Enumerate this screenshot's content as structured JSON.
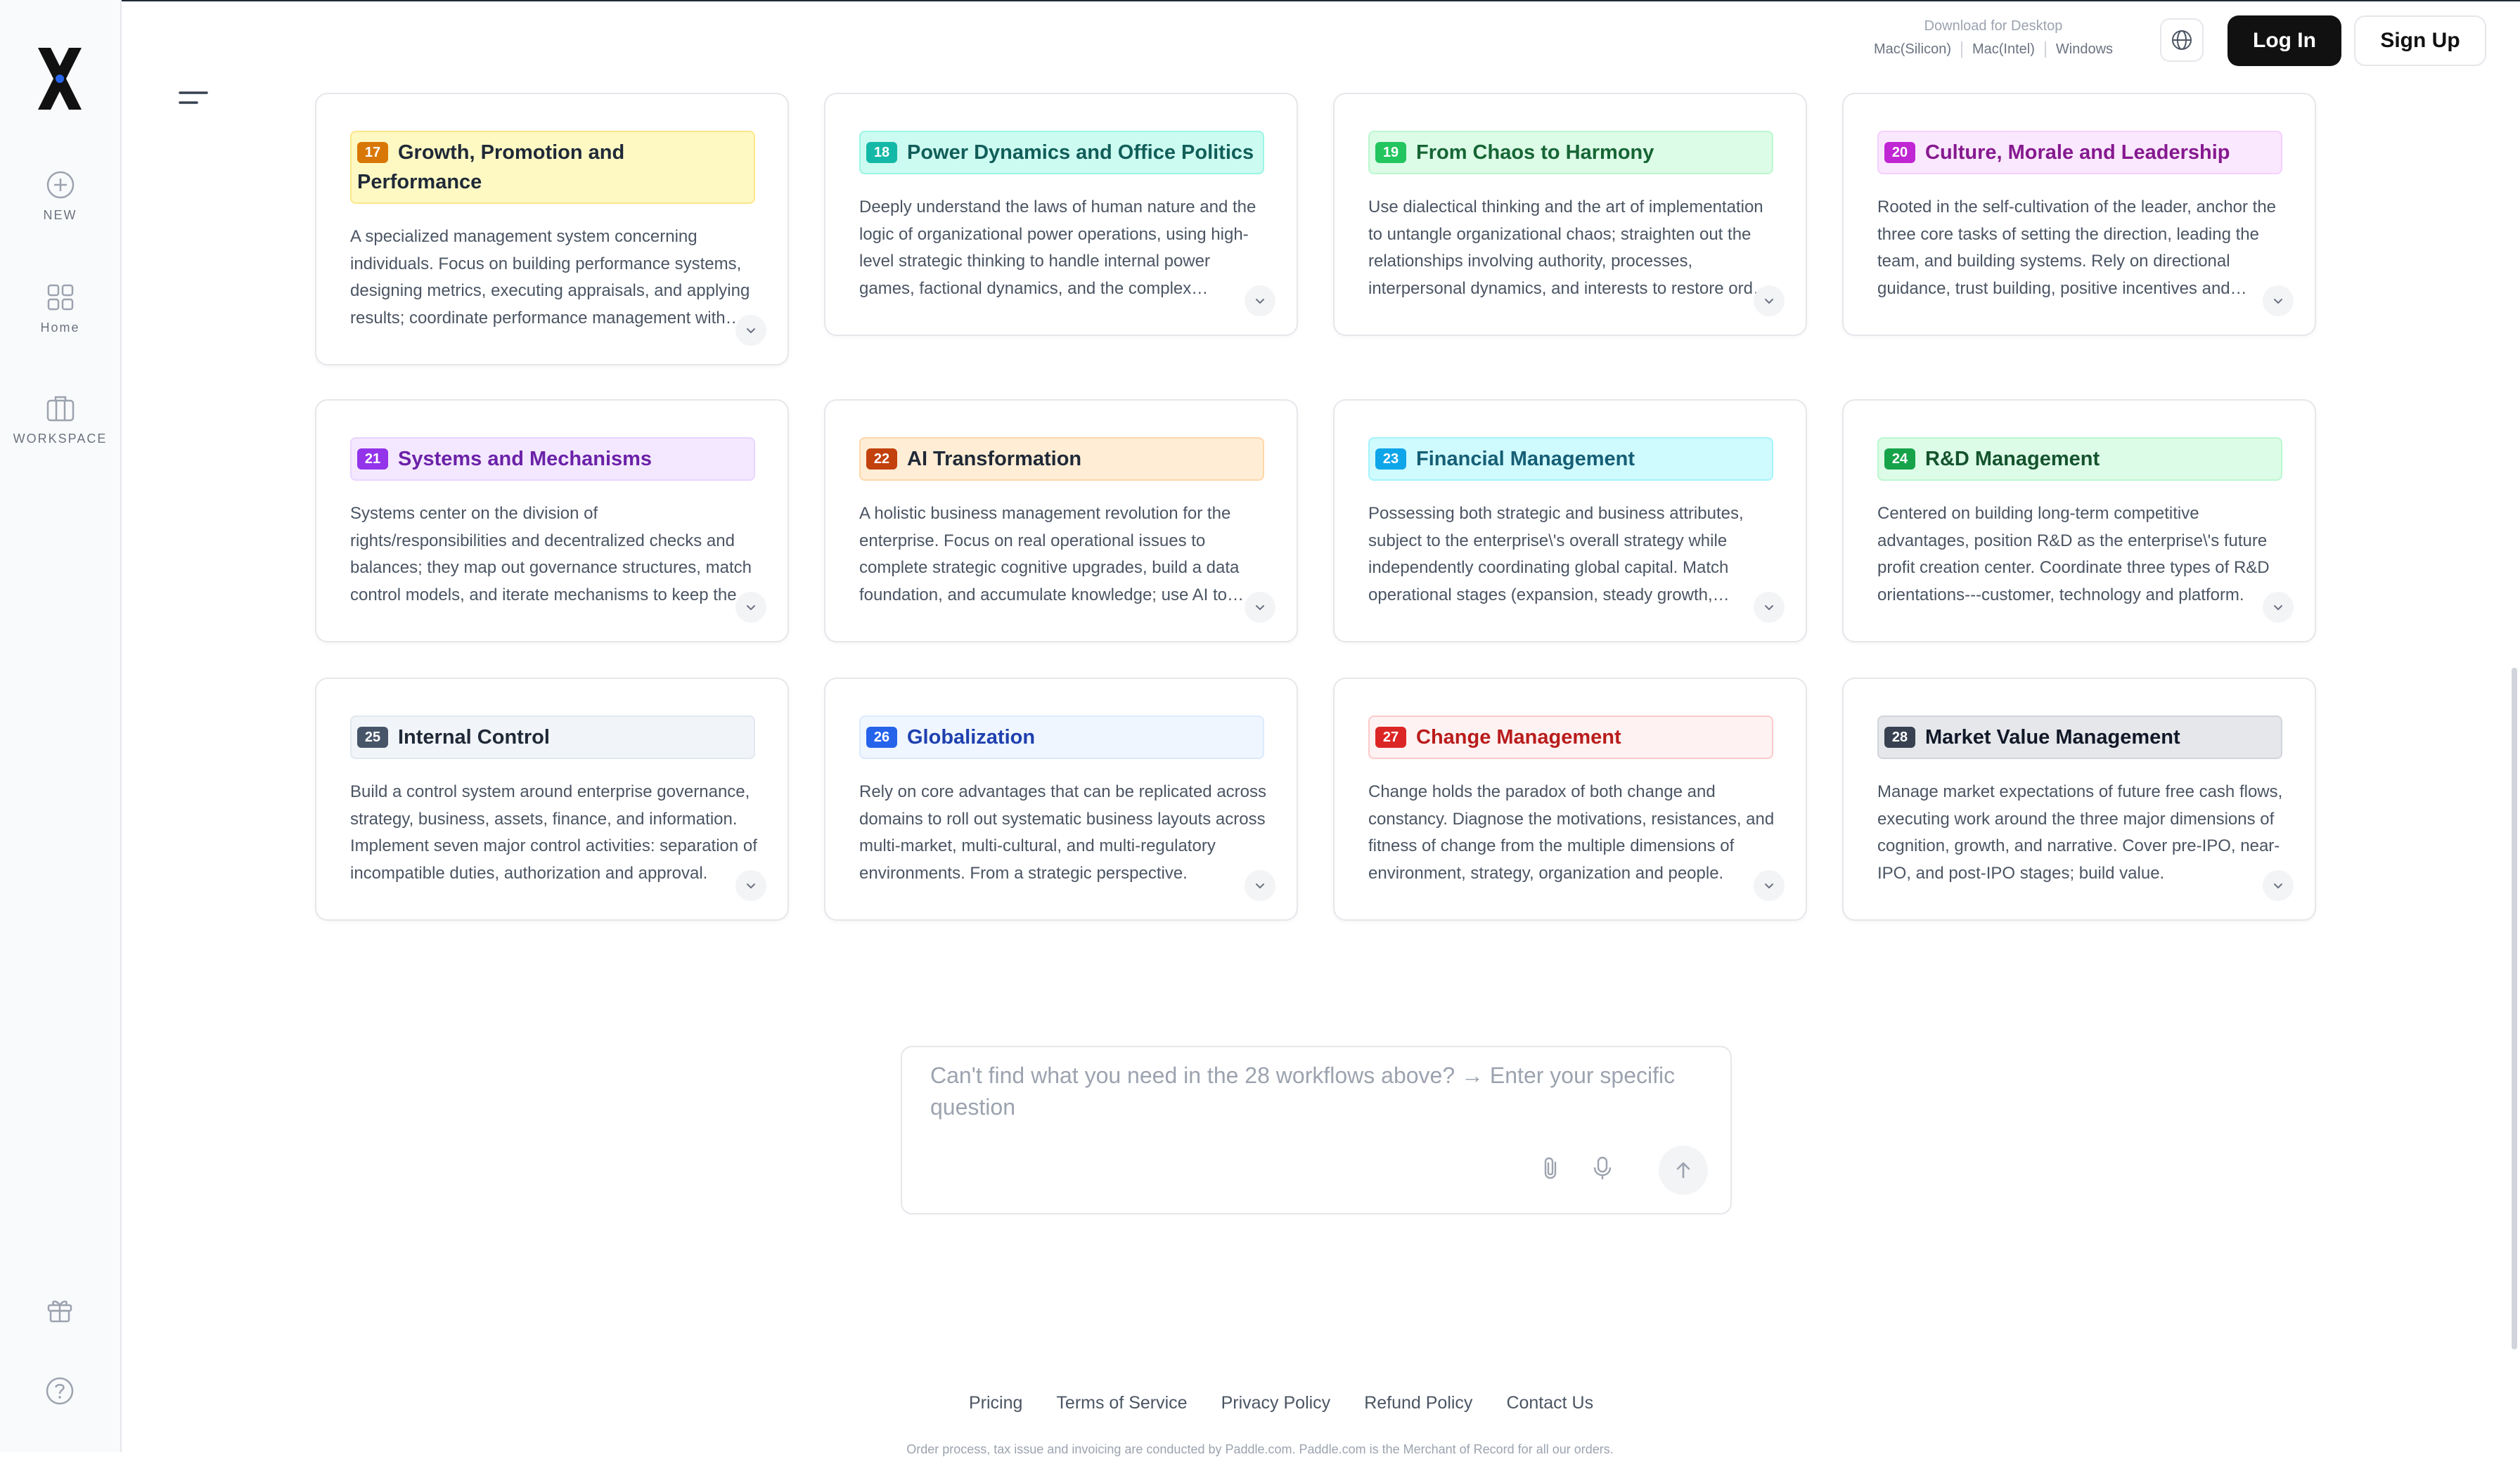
{
  "sidebar": {
    "new_label": "NEW",
    "home_label": "Home",
    "workspace_label": "WORKSPACE"
  },
  "header": {
    "download_title": "Download for Desktop",
    "download_links": [
      "Mac(Silicon)",
      "Mac(Intel)",
      "Windows"
    ],
    "login_label": "Log In",
    "signup_label": "Sign Up"
  },
  "cards": [
    {
      "num": "17",
      "title": "Growth, Promotion and Performance",
      "badge_color": "#d97706",
      "head_bg": "#fef9c3",
      "head_border": "#fde68a",
      "head_text": "#1f2937",
      "desc": "A specialized management system concerning individuals. Focus on building performance systems, designing metrics, executing appraisals, and applying results; coordinate performance management with promotion and growth paths."
    },
    {
      "num": "18",
      "title": "Power Dynamics and Office Politics",
      "badge_color": "#14b8a6",
      "head_bg": "#ccfbf1",
      "head_border": "#99f6e4",
      "head_text": "#115e59",
      "desc": "Deeply understand the laws of human nature and the logic of organizational power operations, using high-level strategic thinking to handle internal power games, factional dynamics, and the complex relationships behind them."
    },
    {
      "num": "19",
      "title": "From Chaos to Harmony",
      "badge_color": "#22c55e",
      "head_bg": "#dcfce7",
      "head_border": "#bbf7d0",
      "head_text": "#166534",
      "desc": "Use dialectical thinking and the art of implementation to untangle organizational chaos; straighten out the relationships involving authority, processes, interpersonal dynamics, and interests to restore order and harmony."
    },
    {
      "num": "20",
      "title": "Culture, Morale and Leadership",
      "badge_color": "#c026d3",
      "head_bg": "#fae8ff",
      "head_border": "#f5d0fe",
      "head_text": "#86198f",
      "desc": "Rooted in the self-cultivation of the leader, anchor the three core tasks of setting the direction, leading the team, and building systems. Rely on directional guidance, trust building, positive incentives and cultural shaping."
    },
    {
      "num": "21",
      "title": "Systems and Mechanisms",
      "badge_color": "#9333ea",
      "head_bg": "#f3e8ff",
      "head_border": "#e9d5ff",
      "head_text": "#6b21a8",
      "desc": "Systems center on the division of rights/responsibilities and decentralized checks and balances; they map out governance structures, match control models, and iterate mechanisms to keep the organization operating."
    },
    {
      "num": "22",
      "title": "AI Transformation",
      "badge_color": "#c2410c",
      "head_bg": "#ffedd5",
      "head_border": "#fed7aa",
      "head_text": "#1f2937",
      "desc": "A holistic business management revolution for the enterprise. Focus on real operational issues to complete strategic cognitive upgrades, build a data foundation, and accumulate knowledge; use AI to reshape processes."
    },
    {
      "num": "23",
      "title": "Financial Management",
      "badge_color": "#0ea5e9",
      "head_bg": "#cffafe",
      "head_border": "#a5f3fc",
      "head_text": "#155e75",
      "desc": "Possessing both strategic and business attributes, subject to the enterprise\\'s overall strategy while independently coordinating global capital. Match operational stages (expansion, steady growth, contraction)."
    },
    {
      "num": "24",
      "title": "R&D Management",
      "badge_color": "#16a34a",
      "head_bg": "#dcfce7",
      "head_border": "#bbf7d0",
      "head_text": "#14532d",
      "desc": "Centered on building long-term competitive advantages, position R&D as the enterprise\\'s future profit creation center. Coordinate three types of R&D orientations---customer, technology and platform."
    },
    {
      "num": "25",
      "title": "Internal Control",
      "badge_color": "#475569",
      "head_bg": "#f1f5f9",
      "head_border": "#e2e8f0",
      "head_text": "#1f2937",
      "desc": "Build a control system around enterprise governance, strategy, business, assets, finance, and information. Implement seven major control activities: separation of incompatible duties, authorization and approval."
    },
    {
      "num": "26",
      "title": "Globalization",
      "badge_color": "#2563eb",
      "head_bg": "#eff6ff",
      "head_border": "#dbeafe",
      "head_text": "#1e40af",
      "desc": "Rely on core advantages that can be replicated across domains to roll out systematic business layouts across multi-market, multi-cultural, and multi-regulatory environments. From a strategic perspective."
    },
    {
      "num": "27",
      "title": "Change Management",
      "badge_color": "#dc2626",
      "head_bg": "#fef2f2",
      "head_border": "#fecaca",
      "head_text": "#b91c1c",
      "desc": "Change holds the paradox of both change and constancy. Diagnose the motivations, resistances, and fitness of change from the multiple dimensions of environment, strategy, organization and people."
    },
    {
      "num": "28",
      "title": "Market Value Management",
      "badge_color": "#374151",
      "head_bg": "#e5e7eb",
      "head_border": "#d1d5db",
      "head_text": "#111827",
      "desc": "Manage market expectations of future free cash flows, executing work around the three major dimensions of cognition, growth, and narrative. Cover pre-IPO, near-IPO, and post-IPO stages; build value."
    }
  ],
  "ask": {
    "placeholder": "Can't find what you need in the 28 workflows above? → Enter your specific question"
  },
  "footer": {
    "links": [
      "Pricing",
      "Terms of Service",
      "Privacy Policy",
      "Refund Policy",
      "Contact Us"
    ],
    "note": "Order process, tax issue and invoicing are conducted by Paddle.com. Paddle.com is the Merchant of Record for all our orders."
  }
}
